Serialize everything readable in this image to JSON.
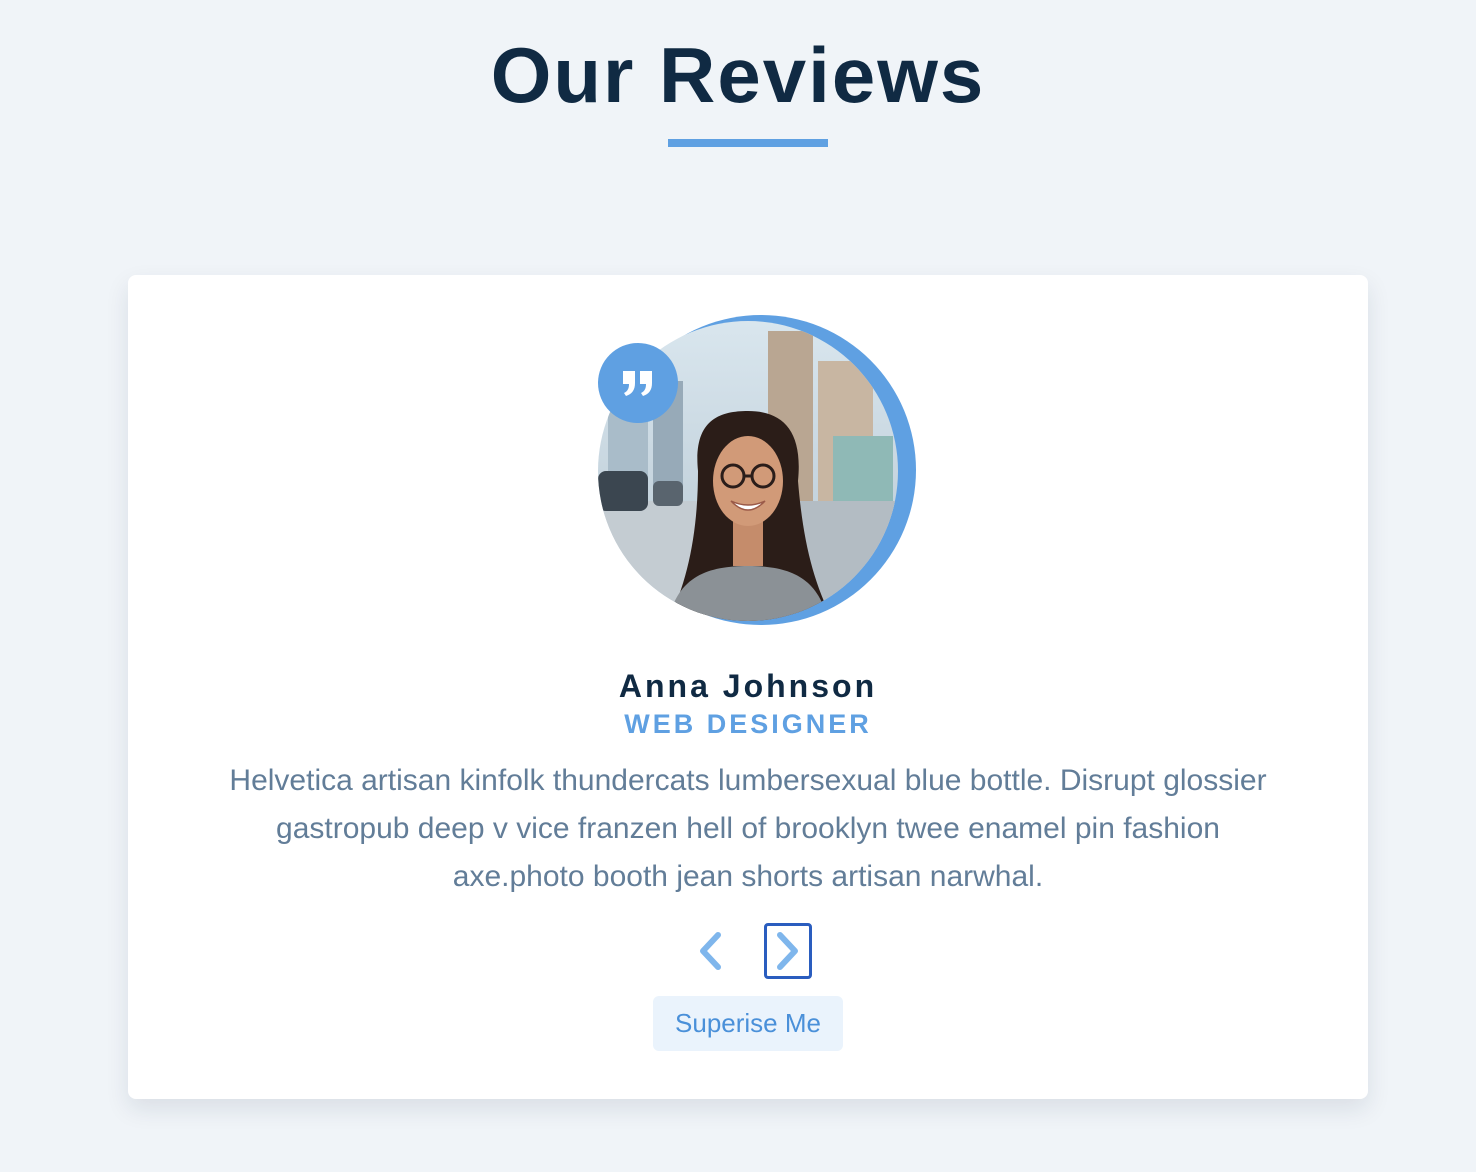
{
  "header": {
    "title": "Our Reviews"
  },
  "review": {
    "name": "Anna Johnson",
    "job": "web designer",
    "text": "Helvetica artisan kinfolk thundercats lumbersexual blue bottle. Disrupt glossier gastropub deep v vice franzen hell of brooklyn twee enamel pin fashion axe.photo booth jean shorts artisan narwhal.",
    "quote_icon": "quote-right-icon"
  },
  "controls": {
    "prev_icon": "chevron-left-icon",
    "next_icon": "chevron-right-icon",
    "random_label": "Superise Me"
  },
  "colors": {
    "background": "#f0f4f8",
    "heading": "#102a43",
    "accent": "#5fa0e2",
    "body_text": "#627d98",
    "focus_outline": "#2a5dbf",
    "button_bg": "#eaf3fc"
  }
}
